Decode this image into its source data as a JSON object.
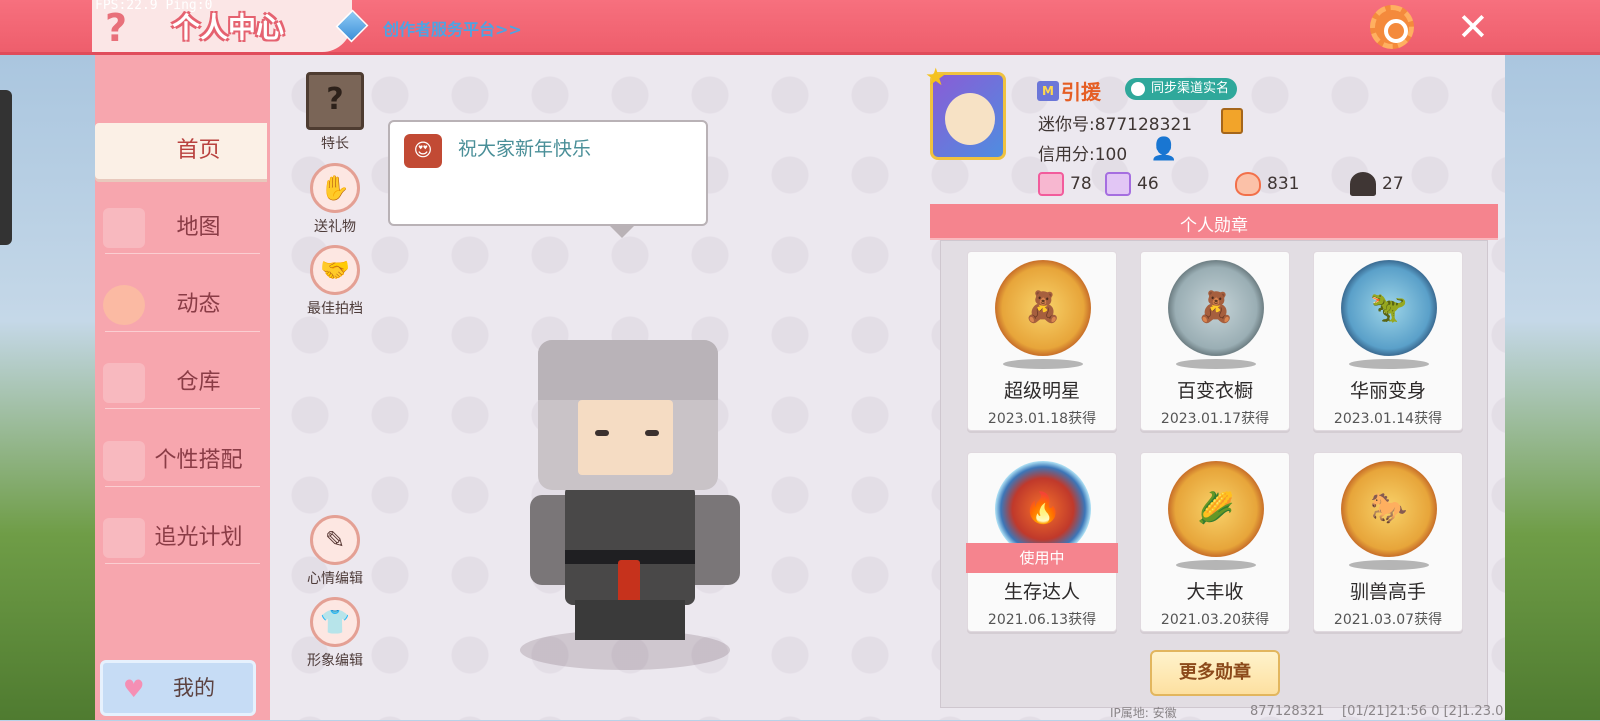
{
  "topbar": {
    "title": "个人中心",
    "fps_text": "FPS:22.9  Ping:0",
    "creator_link": "创作者服务平台>>",
    "help_glyph": "?",
    "close_glyph": "✕"
  },
  "sidebar": {
    "items": [
      {
        "label": "首页",
        "active": true
      },
      {
        "label": "地图"
      },
      {
        "label": "动态"
      },
      {
        "label": "仓库"
      },
      {
        "label": "个性搭配"
      },
      {
        "label": "追光计划"
      }
    ],
    "mine_label": "我的"
  },
  "tools": {
    "specialty": "特长",
    "gift": "送礼物",
    "partner": "最佳拍档",
    "mood_edit": "心情编辑",
    "image_edit": "形象编辑"
  },
  "bubble": {
    "text": "祝大家新年快乐"
  },
  "profile": {
    "nickname": "引援",
    "sync_badge": "同步渠道实名",
    "mini_id": "迷你号:877128321",
    "credit": "信用分:100",
    "stats": [
      {
        "name": "plus",
        "value": "78",
        "color": "#f25c9c"
      },
      {
        "name": "cheer",
        "value": "46",
        "color": "#a56ee0"
      },
      {
        "name": "fire",
        "value": "831",
        "color": "#f2704a"
      },
      {
        "name": "likes",
        "value": "27",
        "color": "#3f3634"
      }
    ]
  },
  "medals": {
    "header": "个人勋章",
    "in_use_label": "使用中",
    "items": [
      {
        "name": "超级明星",
        "date": "2023.01.18获得",
        "style": "gold",
        "in_use": false
      },
      {
        "name": "百变衣橱",
        "date": "2023.01.17获得",
        "style": "silver",
        "in_use": false
      },
      {
        "name": "华丽变身",
        "date": "2023.01.14获得",
        "style": "blue",
        "in_use": false
      },
      {
        "name": "生存达人",
        "date": "2021.06.13获得",
        "style": "fire",
        "in_use": true
      },
      {
        "name": "大丰收",
        "date": "2021.03.20获得",
        "style": "gold",
        "in_use": false
      },
      {
        "name": "驯兽高手",
        "date": "2021.03.07获得",
        "style": "gold",
        "in_use": false
      }
    ],
    "more_button": "更多勋章"
  },
  "footer": {
    "ip": "IP属地: 安徽",
    "id": "877128321",
    "version": "[01/21]21:56 0  [2]1.23.0"
  }
}
